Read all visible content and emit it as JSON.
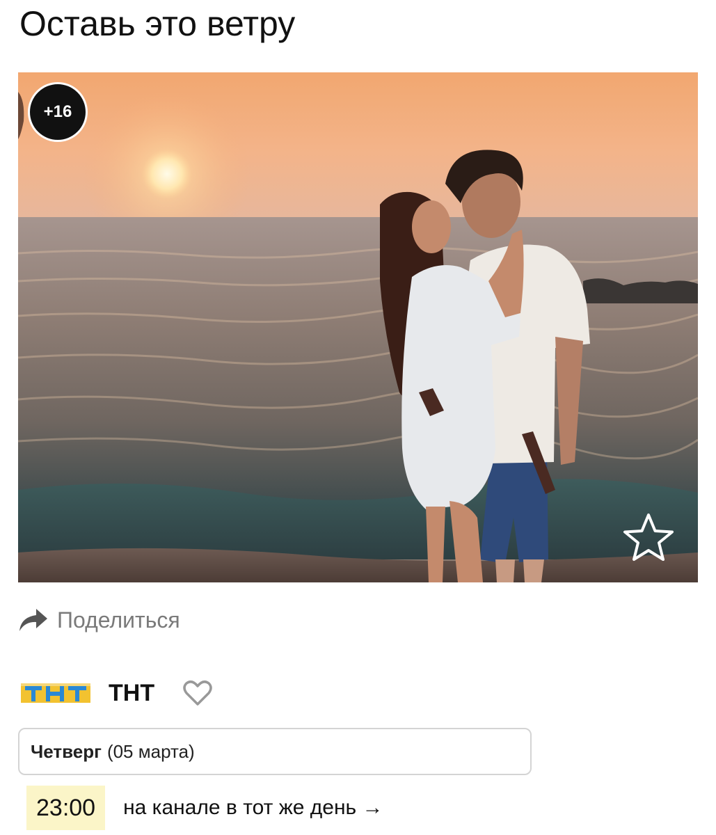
{
  "title": "Оставь это ветру",
  "poster": {
    "age_rating": "+16",
    "favorite_icon": "star-outline-icon"
  },
  "share": {
    "label": "Поделиться",
    "icon": "share-arrow-icon"
  },
  "channel": {
    "name": "ТНТ",
    "logo_text": "ТНТ",
    "heart_icon": "heart-outline-icon"
  },
  "schedule": {
    "day": "Четверг",
    "date": "(05 марта)",
    "time": "23:00",
    "link": "на канале в тот же день →"
  },
  "colors": {
    "time_highlight": "#fbf5c8",
    "share_text": "#7a7a7a",
    "logo_blue": "#2a88d4",
    "logo_gold": "#f2c230"
  }
}
